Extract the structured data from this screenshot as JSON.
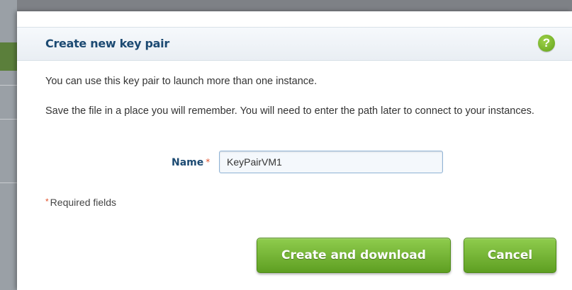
{
  "dialog": {
    "title": "Create new key pair",
    "help_icon": "question-mark-icon",
    "help_glyph": "?",
    "description_1": "You can use this key pair to launch more than one instance.",
    "description_2": "Save the file in a place you will remember. You will need to enter the path later to connect to your instances.",
    "name_field": {
      "label": "Name",
      "required_marker": "*",
      "value": "KeyPairVM1"
    },
    "required_note": "Required fields",
    "buttons": {
      "create_label": "Create and download",
      "cancel_label": "Cancel"
    }
  },
  "colors": {
    "title": "#1c4a72",
    "button_green": "#6aab2a",
    "required_star": "#e0522b"
  }
}
